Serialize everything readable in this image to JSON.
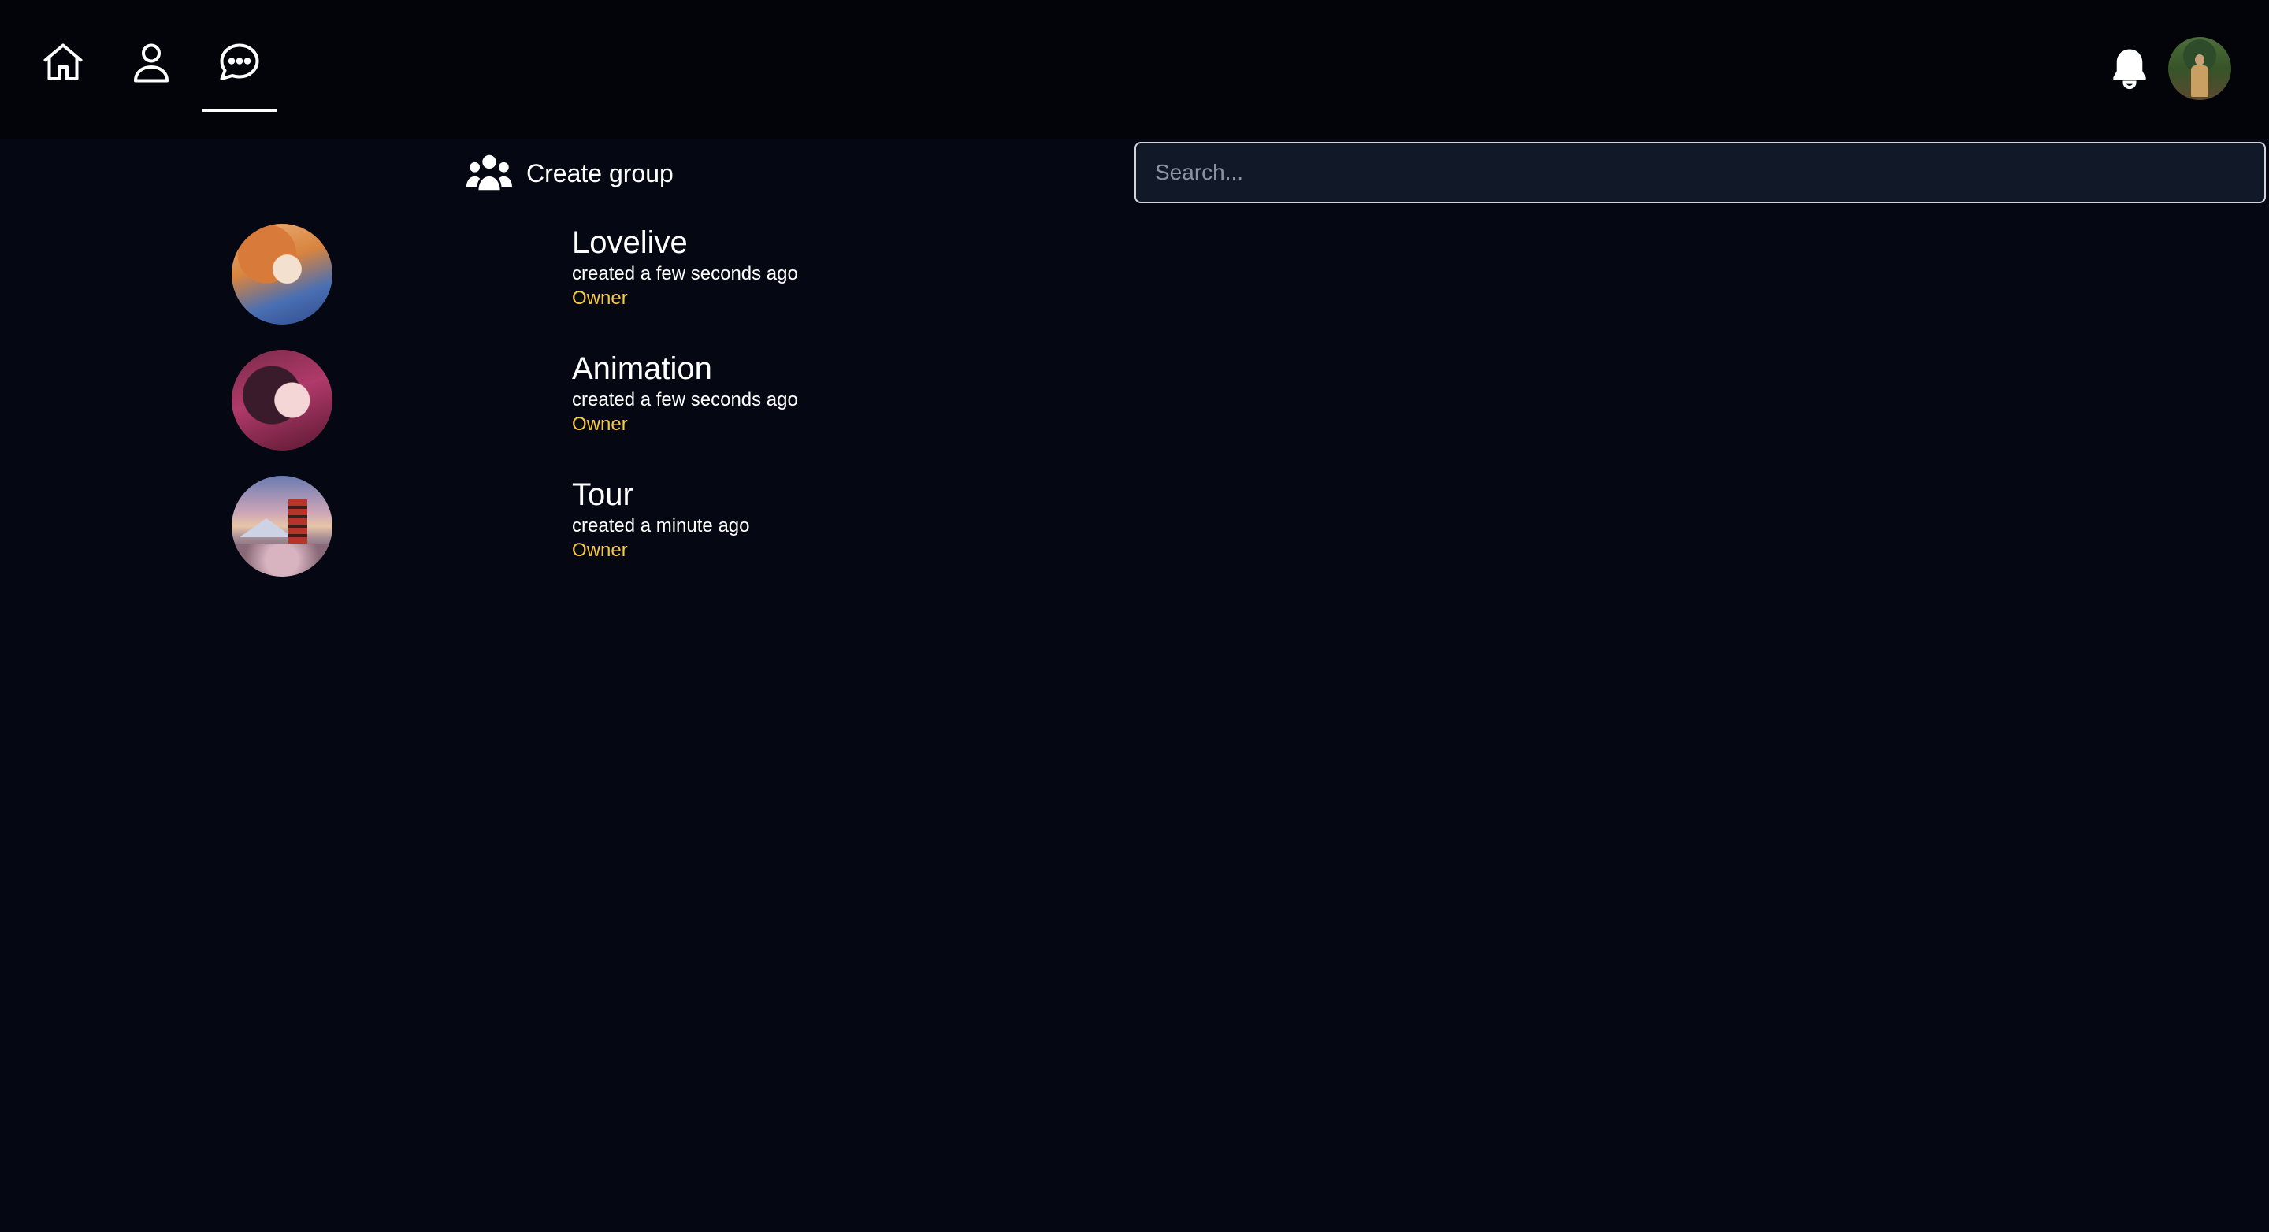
{
  "nav": {
    "items": [
      {
        "name": "home",
        "icon": "home-icon",
        "active": false
      },
      {
        "name": "profile",
        "icon": "user-icon",
        "active": false
      },
      {
        "name": "messages",
        "icon": "chat-bubble-icon",
        "active": true
      }
    ],
    "notifications_icon": "bell-icon",
    "user_avatar_icon": "user-avatar"
  },
  "groups_panel": {
    "create_group_label": "Create group",
    "create_group_icon": "group-users-icon",
    "groups": [
      {
        "name": "Lovelive",
        "created": "created a few seconds ago",
        "role": "Owner"
      },
      {
        "name": "Animation",
        "created": "created a few seconds ago",
        "role": "Owner"
      },
      {
        "name": "Tour",
        "created": "created a minute ago",
        "role": "Owner"
      }
    ]
  },
  "search": {
    "placeholder": "Search...",
    "value": ""
  },
  "colors": {
    "background": "#050712",
    "topbar": "#03040a",
    "role_accent": "#f5c842",
    "search_bg": "#111827"
  }
}
